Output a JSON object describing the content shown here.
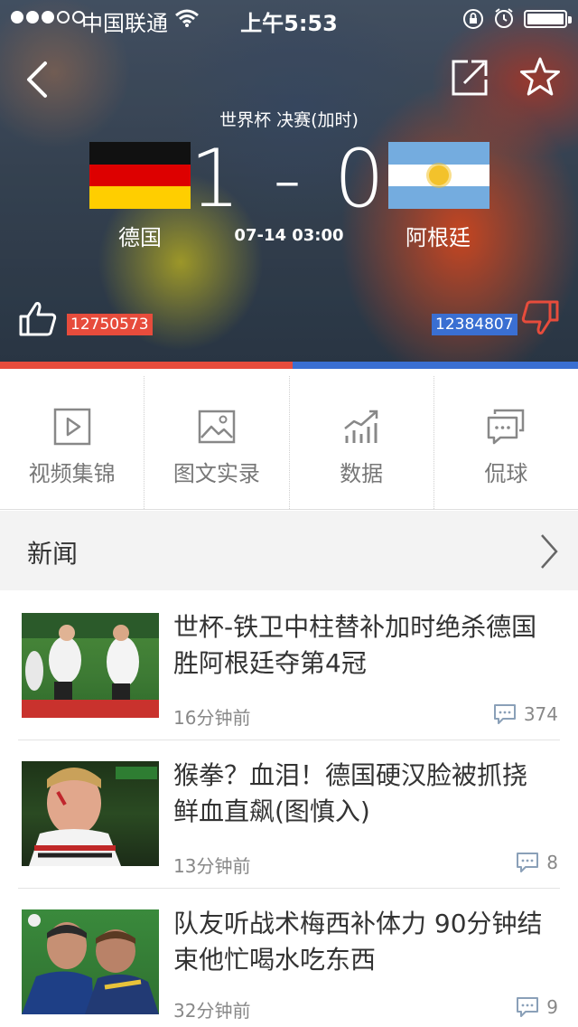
{
  "status_bar": {
    "carrier": "中国联通",
    "time": "上午5:53"
  },
  "match": {
    "stage": "世界杯  决赛(加时)",
    "score": "1 - 0",
    "home_team": "德国",
    "away_team": "阿根廷",
    "kickoff": "07-14 03:00",
    "home_votes": "12750573",
    "away_votes": "12384807",
    "home_vote_share": 0.507,
    "home_color": "#e74c3c",
    "away_color": "#3a6fd2"
  },
  "features": [
    {
      "label": "视频集锦",
      "icon": "video-icon"
    },
    {
      "label": "图文实录",
      "icon": "image-icon"
    },
    {
      "label": "数据",
      "icon": "chart-icon"
    },
    {
      "label": "侃球",
      "icon": "chat-icon"
    }
  ],
  "news": {
    "section_title": "新闻",
    "items": [
      {
        "headline": "世杯-铁卫中柱替补加时绝杀德国胜阿根廷夺第4冠",
        "time": "16分钟前",
        "comments": "374"
      },
      {
        "headline": "猴拳？血泪！德国硬汉脸被抓挠 鲜血直飙(图慎入)",
        "time": "13分钟前",
        "comments": "8"
      },
      {
        "headline": "队友听战术梅西补体力 90分钟结束他忙喝水吃东西",
        "time": "32分钟前",
        "comments": "9"
      }
    ]
  }
}
